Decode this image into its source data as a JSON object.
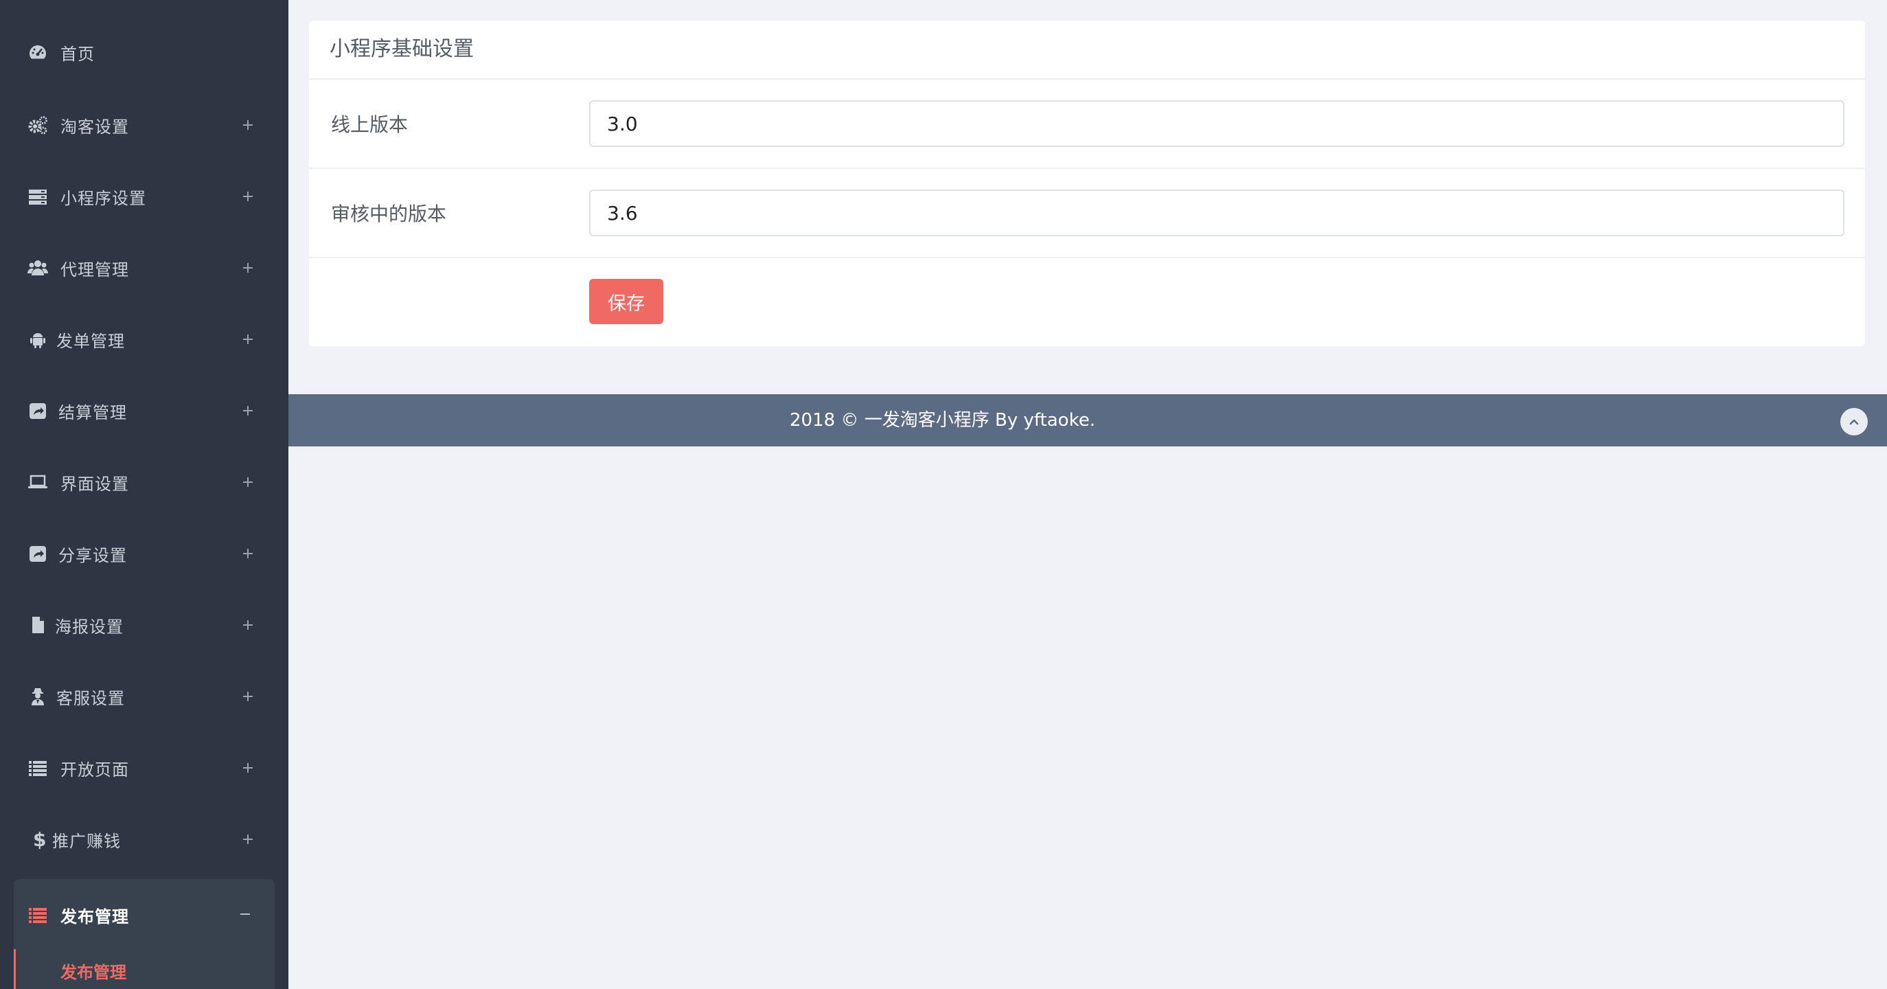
{
  "sidebar": {
    "items": [
      {
        "label": "首页",
        "icon": "dashboard-icon"
      },
      {
        "label": "淘客设置",
        "icon": "cogs-icon"
      },
      {
        "label": "小程序设置",
        "icon": "server-icon"
      },
      {
        "label": "代理管理",
        "icon": "users-icon"
      },
      {
        "label": "发单管理",
        "icon": "android-icon"
      },
      {
        "label": "结算管理",
        "icon": "share-square-icon"
      },
      {
        "label": "界面设置",
        "icon": "laptop-icon"
      },
      {
        "label": "分享设置",
        "icon": "share-square-icon"
      },
      {
        "label": "海报设置",
        "icon": "file-icon"
      },
      {
        "label": "客服设置",
        "icon": "user-secret-icon"
      },
      {
        "label": "开放页面",
        "icon": "list-icon"
      },
      {
        "label": "推广赚钱",
        "icon": "dollar-icon"
      }
    ],
    "active_group": {
      "label": "发布管理",
      "icon": "list-icon"
    },
    "active_sub": {
      "label": "发布管理"
    }
  },
  "card": {
    "title": "小程序基础设置",
    "fields": [
      {
        "label": "线上版本",
        "value": "3.0"
      },
      {
        "label": "审核中的版本",
        "value": "3.6"
      }
    ],
    "save_label": "保存"
  },
  "footer": {
    "text": "2018 © 一发淘客小程序 By yftaoke."
  },
  "colors": {
    "sidebar_bg": "#2d3642",
    "accent": "#f06a63",
    "footer_bg": "#5b6b83",
    "page_bg": "#f0f2f7"
  }
}
